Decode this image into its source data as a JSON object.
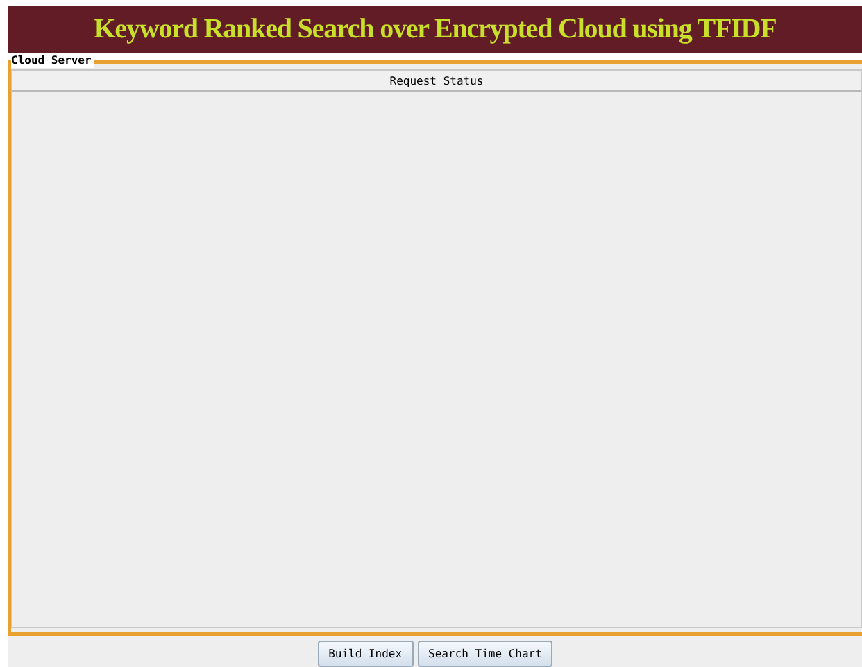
{
  "window": {
    "title": "Keyword Ranked Search over Encrypted Cloud using TFIDF"
  },
  "panel": {
    "title": "Cloud Server",
    "table": {
      "columns": [
        "Request Status"
      ]
    }
  },
  "buttons": [
    "Build Index",
    "Search Time Chart"
  ]
}
